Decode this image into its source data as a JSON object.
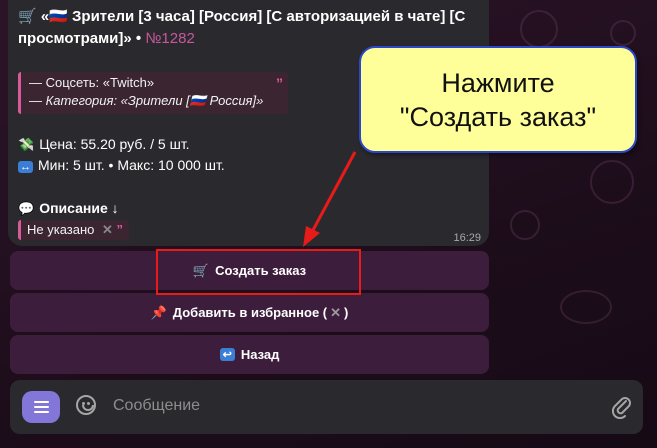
{
  "message": {
    "title": "🛒 «🇷🇺 Зрители [3 часа] [Россия] [С авторизацией в чате] [С просмотрами]» •",
    "order_number": "№1282",
    "social_line": "— Соцсеть: «Twitch»",
    "category_line": "— Категория: «Зрители [🇷🇺 Россия]»",
    "price_text": "Цена: 55.20 руб. / 5 шт.",
    "minmax_text": "Мин: 5 шт. • Макс: 10 000 шт.",
    "description_title": "Описание ↓",
    "description_value": "Не указано",
    "time": "16:29",
    "quote_mark": "”"
  },
  "buttons": {
    "create_order": "Создать заказ",
    "add_favorite": "Добавить в избранное (",
    "add_favorite_close": ")",
    "back": "Назад"
  },
  "composer": {
    "placeholder": "Сообщение"
  },
  "annotation": {
    "line1": "Нажмите",
    "line2": "\"Создать заказ\""
  },
  "icons": {
    "menu": "menu-icon",
    "emoji": "smile-icon",
    "attach": "paperclip-icon",
    "cart": "cart-icon",
    "pin": "pin-icon",
    "back": "back-arrow-icon",
    "money": "money-icon",
    "arrows": "left-right-arrow-icon",
    "speech": "speech-bubble-icon"
  },
  "colors": {
    "accent": "#8376d9",
    "quote_border": "#d85a9b",
    "highlight": "#e81a1a",
    "callout_bg": "#ffff99"
  }
}
